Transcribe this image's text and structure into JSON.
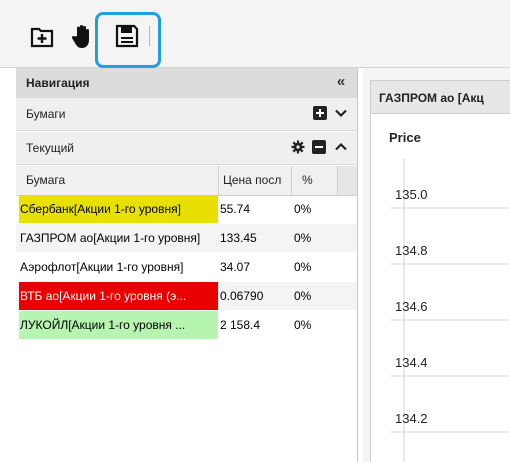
{
  "toolbar": {
    "buttons": [
      {
        "name": "add-tab-button",
        "icon": "plus-square-icon"
      },
      {
        "name": "hand-tool-button",
        "icon": "hand-icon"
      },
      {
        "name": "save-button",
        "icon": "floppy-disk-icon"
      }
    ],
    "highlight_color": "#1f9fe0"
  },
  "navigation": {
    "title": "Навигация",
    "collapse_glyph": "«",
    "sections": [
      {
        "label": "Бумаги"
      },
      {
        "label": "Текущий"
      }
    ]
  },
  "table": {
    "columns": [
      "Бумага",
      "Цена посл",
      "%"
    ],
    "rows": [
      {
        "name": "Сбербанк[Акции 1-го уровня]",
        "price": "55.74",
        "pct": "0%",
        "bg": "#e8e000",
        "fg": "#000000"
      },
      {
        "name": "ГАЗПРОМ ао[Акции 1-го уровня]",
        "price": "133.45",
        "pct": "0%",
        "bg": "#f4f4f4",
        "fg": "#000000"
      },
      {
        "name": "Аэрофлот[Акции 1-го уровня]",
        "price": "34.07",
        "pct": "0%",
        "bg": "#ffffff",
        "fg": "#000000"
      },
      {
        "name": "ВТБ ао[Акции 1-го уровня (э...",
        "price": "0.06790",
        "pct": "0%",
        "bg": "#e80000",
        "fg": "#ffffff"
      },
      {
        "name": "ЛУКОЙЛ[Акции 1-го уровня ...",
        "price": "2 158.4",
        "pct": "0%",
        "bg": "#b6f5b0",
        "fg": "#000000"
      }
    ]
  },
  "chart": {
    "tab_title": "ГАЗПРОМ ао [Акц",
    "axis_title": "Price",
    "ticks": [
      "135.0",
      "134.8",
      "134.6",
      "134.4",
      "134.2"
    ]
  }
}
